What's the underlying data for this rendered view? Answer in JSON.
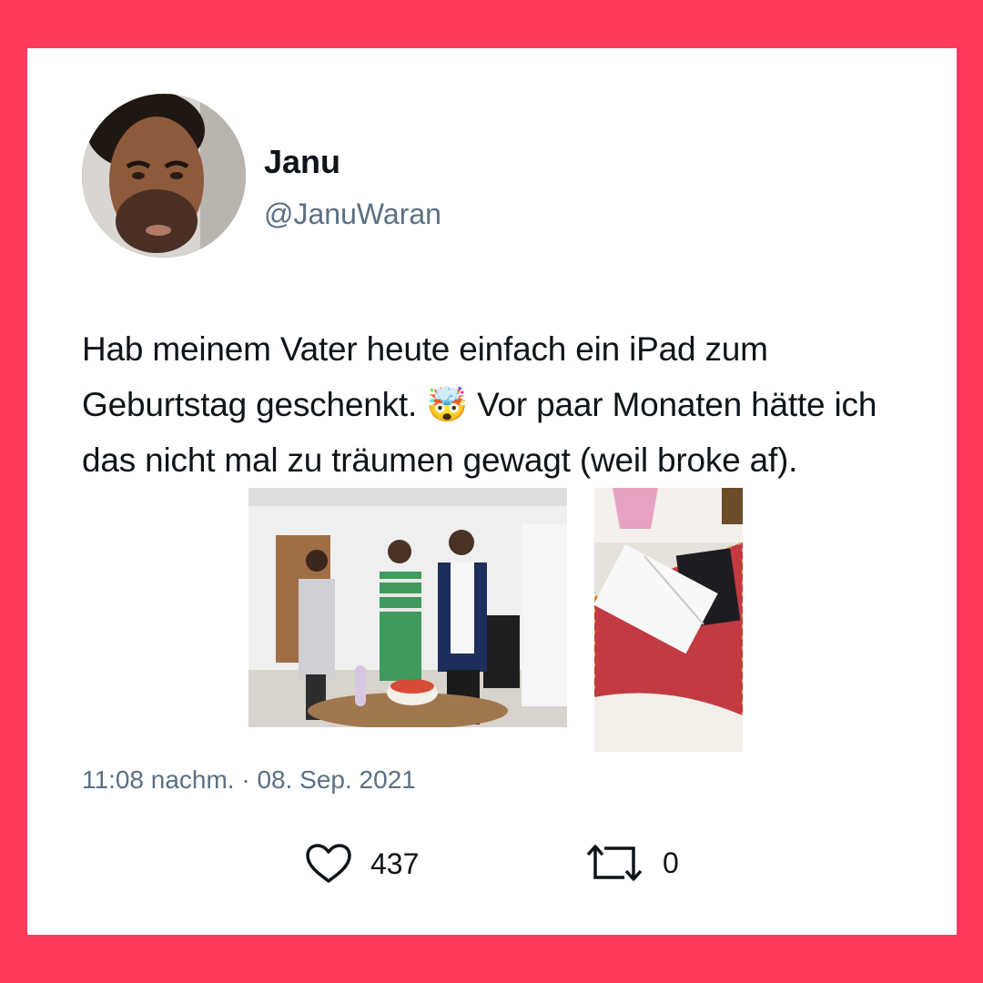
{
  "tweet": {
    "display_name": "Janu",
    "handle": "@JanuWaran",
    "text_before_emoji": "Hab meinem Vater heute einfach ein iPad zum Geburtstag geschenkt. ",
    "emoji": "🤯",
    "text_after_emoji": " Vor paar Monaten hätte ich das nicht mal zu träumen gewagt (weil broke af).",
    "timestamp": "11:08 nachm. · 08. Sep. 2021",
    "likes": "437",
    "retweets": "0"
  },
  "icons": {
    "like": "heart-icon",
    "retweet": "retweet-icon"
  },
  "colors": {
    "frame": "#ff3a5c",
    "card": "#ffffff",
    "text": "#0f1419",
    "muted": "#5b7083"
  }
}
